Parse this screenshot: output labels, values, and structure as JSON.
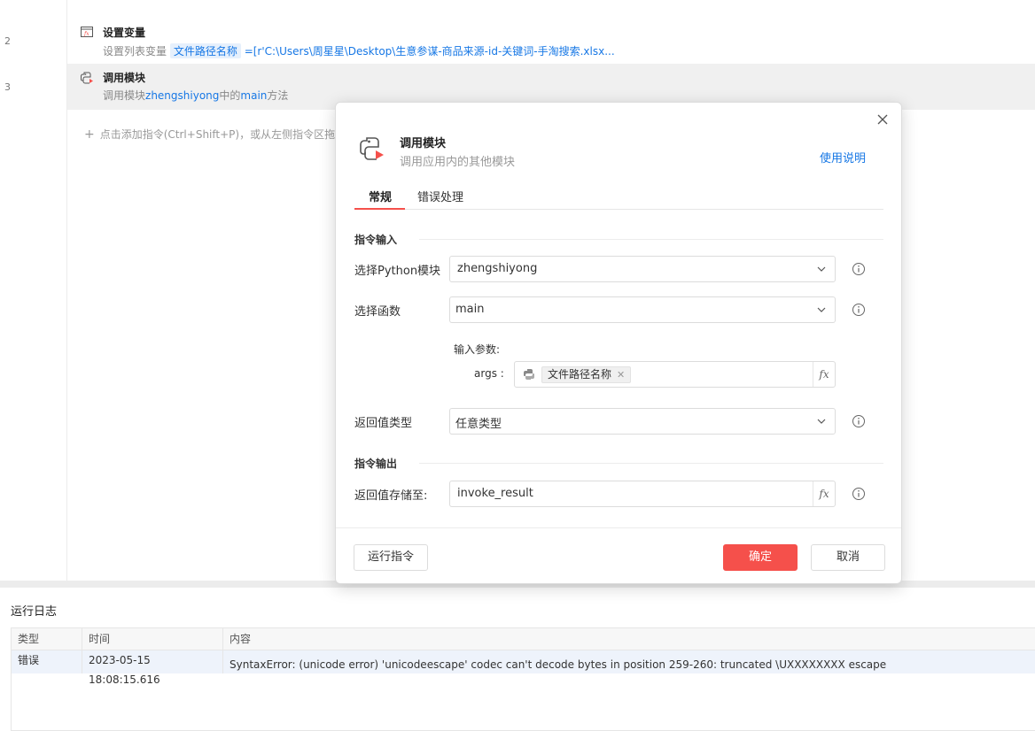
{
  "editor": {
    "line_numbers": [
      "2",
      "3"
    ],
    "rows": [
      {
        "title": "设置变量",
        "desc_prefix": "设置列表变量",
        "var_name": "文件路径名称",
        "desc_value": "=[r'C:\\Users\\周星星\\Desktop\\生意参谋-商品来源-id-关键词-手淘搜索.xlsx..."
      },
      {
        "title": "调用模块",
        "desc_prefix": "调用模块",
        "module": "zhengshiyong",
        "desc_mid": "中的",
        "method": "main",
        "desc_suffix": "方法"
      }
    ],
    "add_hint": "点击添加指令(Ctrl+Shift+P)，或从左侧指令区拖入"
  },
  "log": {
    "title": "运行日志",
    "columns": [
      "类型",
      "时间",
      "内容"
    ],
    "rows": [
      {
        "type": "错误",
        "time": "2023-05-15 18:08:15.616",
        "content": "SyntaxError: (unicode error) 'unicodeescape' codec can't decode bytes in position 259-260: truncated \\UXXXXXXXX escape"
      }
    ]
  },
  "dialog": {
    "title": "调用模块",
    "subtitle": "调用应用内的其他模块",
    "help_link": "使用说明",
    "tabs": [
      "常规",
      "错误处理"
    ],
    "active_tab": 0,
    "section_input": "指令输入",
    "section_output": "指令输出",
    "fields": {
      "module_label": "选择Python模块",
      "module_value": "zhengshiyong",
      "function_label": "选择函数",
      "function_value": "main",
      "params_title": "输入参数:",
      "args_label": "args :",
      "args_chip": "文件路径名称",
      "return_type_label": "返回值类型",
      "return_type_value": "任意类型",
      "store_label": "返回值存储至:",
      "store_value": "invoke_result"
    },
    "buttons": {
      "run": "运行指令",
      "ok": "确定",
      "cancel": "取消"
    }
  },
  "colors": {
    "accent": "#f5504b",
    "link": "#1677e5",
    "selected_row": "#f0f0f0",
    "log_row": "#eef3fb"
  },
  "icons": {
    "set_variable": "variable-icon",
    "invoke_module": "python-module-icon",
    "close": "close-icon",
    "info": "info-icon",
    "chevron": "chevron-down-icon",
    "fx": "fx-icon"
  }
}
